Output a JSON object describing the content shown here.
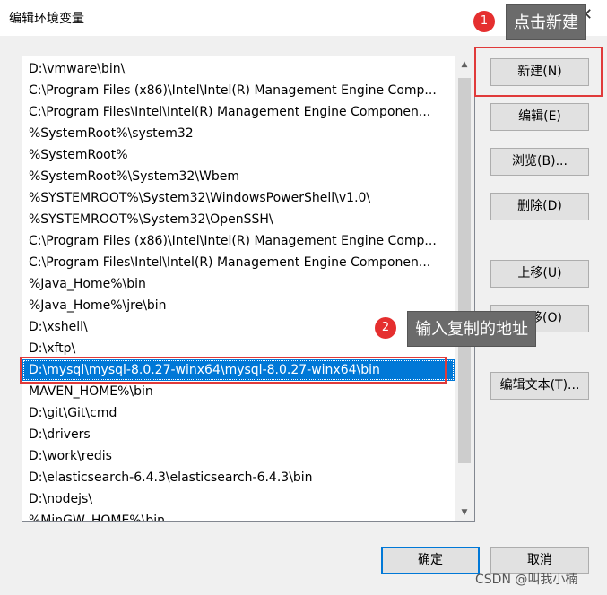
{
  "dialog": {
    "title": "编辑环境变量",
    "close_glyph": "✕"
  },
  "list": {
    "items": [
      "D:\\vmware\\bin\\",
      "C:\\Program Files (x86)\\Intel\\Intel(R) Management Engine Comp...",
      "C:\\Program Files\\Intel\\Intel(R) Management Engine Componen...",
      "%SystemRoot%\\system32",
      "%SystemRoot%",
      "%SystemRoot%\\System32\\Wbem",
      "%SYSTEMROOT%\\System32\\WindowsPowerShell\\v1.0\\",
      "%SYSTEMROOT%\\System32\\OpenSSH\\",
      "C:\\Program Files (x86)\\Intel\\Intel(R) Management Engine Comp...",
      "C:\\Program Files\\Intel\\Intel(R) Management Engine Componen...",
      "%Java_Home%\\bin",
      "%Java_Home%\\jre\\bin",
      "D:\\xshell\\",
      "D:\\xftp\\",
      "D:\\mysql\\mysql-8.0.27-winx64\\mysql-8.0.27-winx64\\bin",
      "MAVEN_HOME%\\bin",
      "D:\\git\\Git\\cmd",
      "D:\\drivers",
      "D:\\work\\redis",
      "D:\\elasticsearch-6.4.3\\elasticsearch-6.4.3\\bin",
      "D:\\nodejs\\",
      "%MinGW_HOME%\\bin"
    ],
    "selected_index": 14
  },
  "buttons": {
    "new": "新建(N)",
    "edit": "编辑(E)",
    "browse": "浏览(B)...",
    "delete": "删除(D)",
    "move_up": "上移(U)",
    "move_down": "下移(O)",
    "edit_text": "编辑文本(T)...",
    "ok": "确定",
    "cancel": "取消"
  },
  "annotations": {
    "step1_number": "1",
    "step1_text": "点击新建",
    "step2_number": "2",
    "step2_text": "输入复制的地址"
  },
  "watermark": "CSDN @叫我小楠",
  "colors": {
    "selection": "#0078d7",
    "annotation_red": "#e03a3a",
    "callout_bg": "#6b6b6b"
  }
}
